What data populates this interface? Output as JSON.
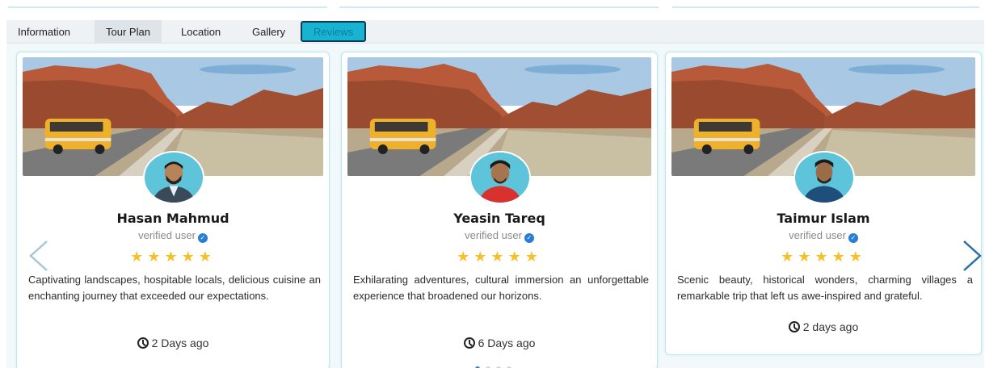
{
  "tabs": [
    {
      "label": "Information"
    },
    {
      "label": "Tour Plan"
    },
    {
      "label": "Location"
    },
    {
      "label": "Gallery"
    },
    {
      "label": "Reviews"
    }
  ],
  "reviews": [
    {
      "name": "Hasan Mahmud",
      "status": "verified user",
      "rating": 5,
      "stars": "★★★★★",
      "text": "Captivating landscapes, hospitable locals, delicious cuisine an enchanting journey that exceeded our expectations.",
      "time": "2 Days ago",
      "shirt_color": "#3a4a5a"
    },
    {
      "name": "Yeasin Tareq",
      "status": "verified user",
      "rating": 5,
      "stars": "★★★★★",
      "text": "Exhilarating adventures, cultural immersion an unforgettable experience that broadened our horizons.",
      "time": "6 Days ago",
      "shirt_color": "#d9322e"
    },
    {
      "name": "Taimur Islam",
      "status": "verified user",
      "rating": 5,
      "stars": "★★★★★",
      "text": "Scenic beauty, historical wonders, charming villages a remarkable trip that left us awe-inspired and grateful.",
      "time": "2 days ago",
      "shirt_color": "#1f4e7a"
    }
  ],
  "carousel": {
    "dot_count": 4,
    "active_dot": 0
  },
  "icons": {
    "prev": "chevron-left-icon",
    "next": "chevron-right-icon",
    "verified": "verified-check-icon",
    "clock": "clock-icon",
    "star": "star-icon"
  },
  "colors": {
    "accent": "#17b3d1",
    "star": "#f7c02a",
    "verified": "#2a7dd6",
    "arrow_prev": "#a8c6d8",
    "arrow_next": "#2a6fa5"
  }
}
